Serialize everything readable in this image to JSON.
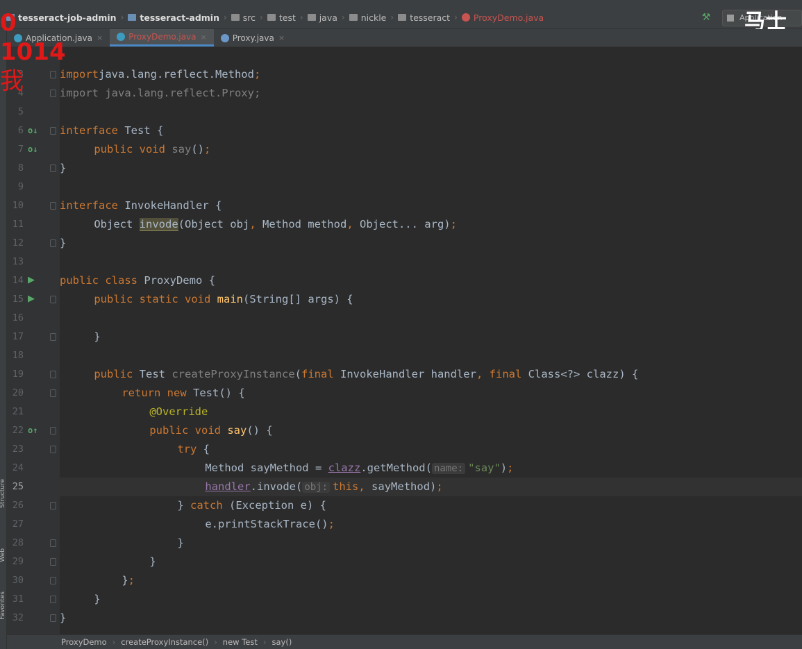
{
  "breadcrumbs": [
    {
      "label": "tesseract-job-admin",
      "kind": "module",
      "bold": true
    },
    {
      "label": "tesseract-admin",
      "kind": "module",
      "bold": true
    },
    {
      "label": "src",
      "kind": "folder",
      "bold": false
    },
    {
      "label": "test",
      "kind": "folder",
      "bold": false
    },
    {
      "label": "java",
      "kind": "folder",
      "bold": false
    },
    {
      "label": "nickle",
      "kind": "folder",
      "bold": false
    },
    {
      "label": "tesseract",
      "kind": "folder",
      "bold": false
    },
    {
      "label": "ProxyDemo.java",
      "kind": "file",
      "bold": false
    }
  ],
  "run_config_label": "Application",
  "watermark_text": "马士",
  "overlay": {
    "line1": "0",
    "line2": "1014",
    "line3": "我"
  },
  "tabs": [
    {
      "label": "Application.java",
      "icon": "class-icon",
      "active": false
    },
    {
      "label": "ProxyDemo.java",
      "icon": "class-icon",
      "active": true
    },
    {
      "label": "Proxy.java",
      "icon": "interface-icon",
      "active": false
    }
  ],
  "tool_windows": [
    "Structure",
    "Web",
    "Favorites"
  ],
  "editor": {
    "current_line": 25,
    "lines": [
      {
        "n": 3,
        "fold": true,
        "mark": "",
        "tokens": [
          [
            "kw",
            "import"
          ],
          [
            "",
            "java.lang.reflect.Method"
          ],
          [
            "kw",
            ";"
          ]
        ]
      },
      {
        "n": 4,
        "fold": true,
        "mark": "",
        "tokens": [
          [
            "unused",
            "import java.lang.reflect.Proxy;"
          ]
        ]
      },
      {
        "n": 5,
        "fold": false,
        "mark": "",
        "tokens": []
      },
      {
        "n": 6,
        "fold": true,
        "mark": "impl",
        "tokens": [
          [
            "kw",
            "interface"
          ],
          [
            "",
            " Test {"
          ]
        ]
      },
      {
        "n": 7,
        "fold": false,
        "mark": "impl",
        "tokens": [
          [
            "",
            " "
          ],
          [
            "kw",
            "public void"
          ],
          [
            "",
            " "
          ],
          [
            "dim",
            "say"
          ],
          [
            "",
            "()"
          ],
          [
            "kw",
            ";"
          ]
        ]
      },
      {
        "n": 8,
        "fold": true,
        "mark": "",
        "tokens": [
          [
            "",
            "}"
          ]
        ]
      },
      {
        "n": 9,
        "fold": false,
        "mark": "",
        "tokens": []
      },
      {
        "n": 10,
        "fold": true,
        "mark": "",
        "tokens": [
          [
            "kw",
            "interface"
          ],
          [
            "",
            " InvokeHandler {"
          ]
        ]
      },
      {
        "n": 11,
        "fold": false,
        "mark": "",
        "tokens": [
          [
            "",
            " Object "
          ],
          [
            "hl",
            "invode"
          ],
          [
            "",
            "(Object obj"
          ],
          [
            "kw",
            ","
          ],
          [
            "",
            " Method method"
          ],
          [
            "kw",
            ","
          ],
          [
            "",
            " Object... arg)"
          ],
          [
            "kw",
            ";"
          ]
        ]
      },
      {
        "n": 12,
        "fold": true,
        "mark": "",
        "tokens": [
          [
            "",
            "}"
          ]
        ]
      },
      {
        "n": 13,
        "fold": false,
        "mark": "",
        "tokens": []
      },
      {
        "n": 14,
        "fold": false,
        "mark": "run",
        "tokens": [
          [
            "kw",
            "public class"
          ],
          [
            "",
            " ProxyDemo {"
          ]
        ]
      },
      {
        "n": 15,
        "fold": true,
        "mark": "run",
        "tokens": [
          [
            "",
            " "
          ],
          [
            "kw",
            "public static void"
          ],
          [
            "",
            " "
          ],
          [
            "fn",
            "main"
          ],
          [
            "",
            "(String[] args) {"
          ]
        ]
      },
      {
        "n": 16,
        "fold": false,
        "mark": "",
        "tokens": []
      },
      {
        "n": 17,
        "fold": true,
        "mark": "",
        "tokens": [
          [
            "",
            " }"
          ]
        ]
      },
      {
        "n": 18,
        "fold": false,
        "mark": "",
        "tokens": []
      },
      {
        "n": 19,
        "fold": true,
        "mark": "",
        "tokens": [
          [
            "",
            " "
          ],
          [
            "kw",
            "public"
          ],
          [
            "",
            " Test "
          ],
          [
            "dim",
            "createProxyInstance"
          ],
          [
            "",
            "("
          ],
          [
            "kw",
            "final"
          ],
          [
            "",
            " InvokeHandler handler"
          ],
          [
            "kw",
            ","
          ],
          [
            "",
            " "
          ],
          [
            "kw",
            "final"
          ],
          [
            "",
            " Class<?> clazz) {"
          ]
        ]
      },
      {
        "n": 20,
        "fold": true,
        "mark": "",
        "tokens": [
          [
            "",
            " "
          ],
          [
            "kw",
            "return new"
          ],
          [
            "",
            " Test() {"
          ]
        ]
      },
      {
        "n": 21,
        "fold": false,
        "mark": "",
        "tokens": [
          [
            "",
            " "
          ],
          [
            "ann",
            "@Override"
          ]
        ]
      },
      {
        "n": 22,
        "fold": true,
        "mark": "override",
        "tokens": [
          [
            "",
            " "
          ],
          [
            "kw",
            "public void"
          ],
          [
            "",
            " "
          ],
          [
            "fn",
            "say"
          ],
          [
            "",
            "() {"
          ]
        ]
      },
      {
        "n": 23,
        "fold": true,
        "mark": "",
        "tokens": [
          [
            "",
            " "
          ],
          [
            "kw",
            "try"
          ],
          [
            "",
            " {"
          ]
        ]
      },
      {
        "n": 24,
        "fold": false,
        "mark": "",
        "tokens": [
          [
            "",
            " Method sayMethod = "
          ],
          [
            "ulfld",
            "clazz"
          ],
          [
            "",
            ".getMethod("
          ],
          [
            "hint",
            "name:"
          ],
          [
            "str",
            "\"say\""
          ],
          [
            "",
            ")"
          ],
          [
            "kw",
            ";"
          ]
        ]
      },
      {
        "n": 25,
        "fold": false,
        "mark": "",
        "tokens": [
          [
            "",
            " "
          ],
          [
            "ulfld",
            "handler"
          ],
          [
            "",
            ".invode("
          ],
          [
            "hint",
            "obj:"
          ],
          [
            "kw",
            "this,"
          ],
          [
            "",
            " sayMethod)"
          ],
          [
            "kw",
            ";"
          ]
        ]
      },
      {
        "n": 26,
        "fold": true,
        "mark": "",
        "tokens": [
          [
            "",
            " } "
          ],
          [
            "kw",
            "catch"
          ],
          [
            "",
            " (Exception e) {"
          ]
        ]
      },
      {
        "n": 27,
        "fold": false,
        "mark": "",
        "tokens": [
          [
            "",
            " e.printStackTrace()"
          ],
          [
            "kw",
            ";"
          ]
        ]
      },
      {
        "n": 28,
        "fold": true,
        "mark": "",
        "tokens": [
          [
            "",
            " }"
          ]
        ]
      },
      {
        "n": 29,
        "fold": true,
        "mark": "",
        "tokens": [
          [
            "",
            " }"
          ]
        ]
      },
      {
        "n": 30,
        "fold": true,
        "mark": "",
        "tokens": [
          [
            "",
            " }"
          ],
          [
            "kw",
            ";"
          ]
        ]
      },
      {
        "n": 31,
        "fold": true,
        "mark": "",
        "tokens": [
          [
            "",
            " }"
          ]
        ]
      },
      {
        "n": 32,
        "fold": true,
        "mark": "",
        "tokens": [
          [
            "",
            "}"
          ]
        ]
      }
    ]
  },
  "status_breadcrumb": [
    "ProxyDemo",
    "createProxyInstance()",
    "new Test",
    "say()"
  ],
  "colors": {
    "keyword": "#cc7832",
    "method": "#ffc66d",
    "string": "#6a8759",
    "annotation": "#bbb529",
    "field": "#9876aa",
    "text": "#a9b7c6",
    "background": "#2b2b2b"
  }
}
